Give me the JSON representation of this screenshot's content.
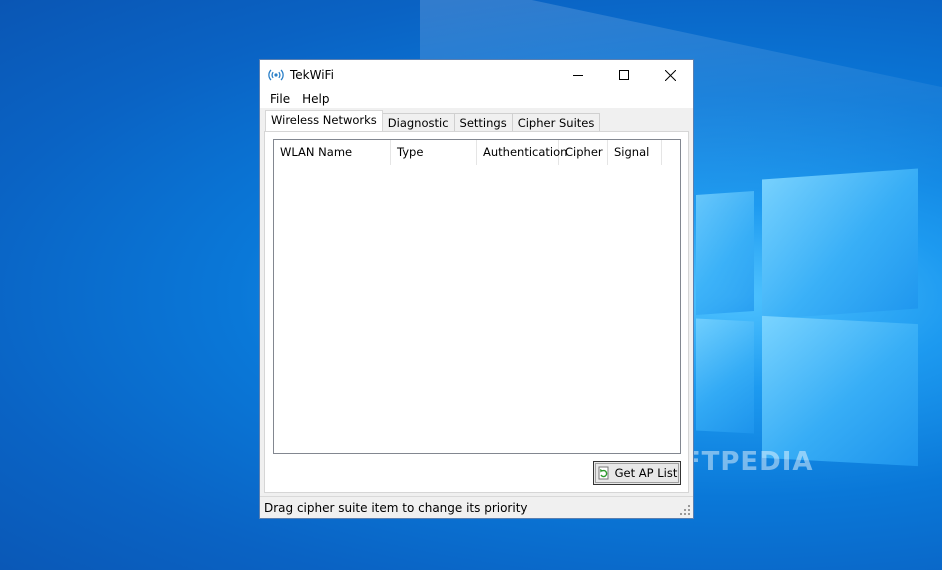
{
  "window": {
    "title": "TekWiFi",
    "controls": {
      "minimize": "minimize-icon",
      "maximize": "maximize-icon",
      "close": "close-icon"
    }
  },
  "menu": [
    {
      "label": "File"
    },
    {
      "label": "Help"
    }
  ],
  "tabs": [
    {
      "label": "Wireless Networks",
      "active": true
    },
    {
      "label": "Diagnostic",
      "active": false
    },
    {
      "label": "Settings",
      "active": false
    },
    {
      "label": "Cipher Suites",
      "active": false
    }
  ],
  "table": {
    "columns": [
      "WLAN Name",
      "Type",
      "Authentication",
      "Cipher",
      "Signal"
    ],
    "rows": []
  },
  "buttons": {
    "get_ap_list": "Get AP List"
  },
  "status": {
    "text": "Drag cipher suite item to change its priority"
  },
  "desktop": {
    "watermark": "SOFTPEDIA"
  },
  "colors": {
    "accent": "#0a78d8",
    "window_border": "#5a7fb0"
  }
}
